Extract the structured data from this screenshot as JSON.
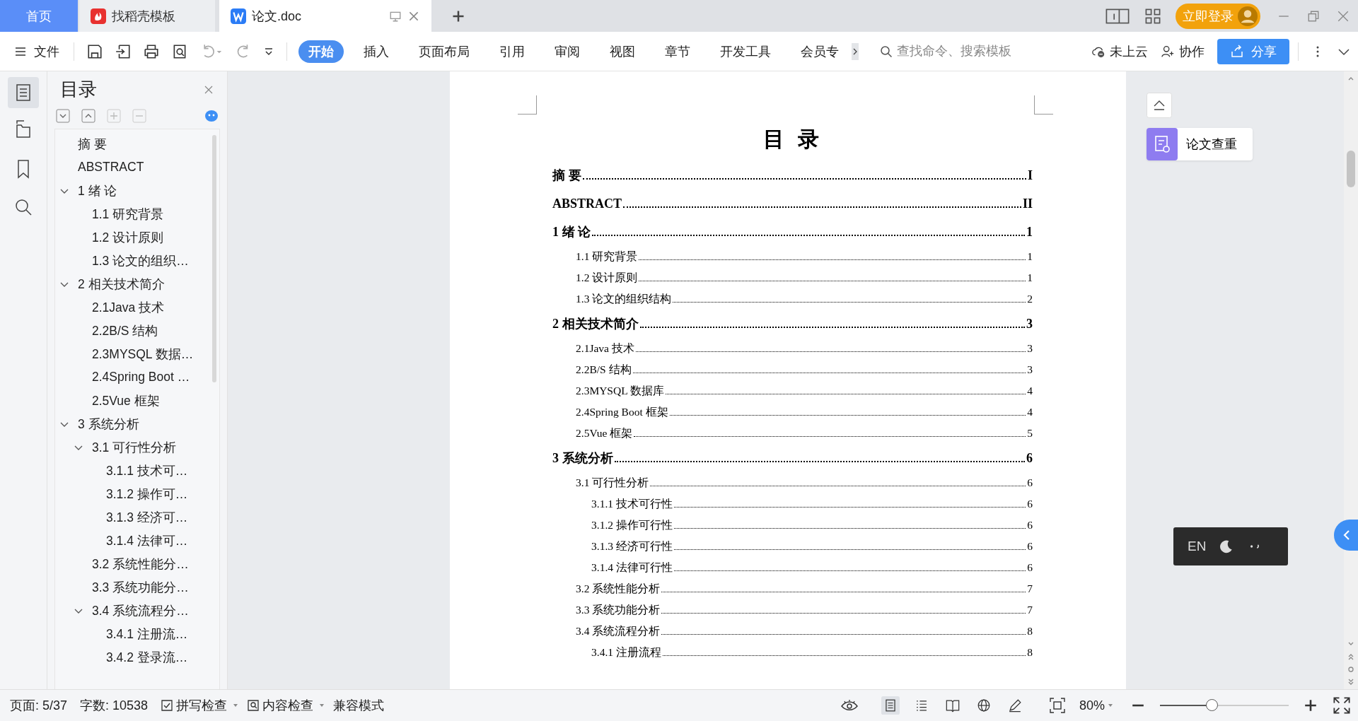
{
  "window_tabs": [
    {
      "label": "首页",
      "kind": "home",
      "selected": false
    },
    {
      "label": "找稻壳模板",
      "kind": "docer",
      "selected": false
    },
    {
      "label": "论文.doc",
      "kind": "doc",
      "selected": true
    }
  ],
  "login_button": "立即登录",
  "file_menu": "文件",
  "ribbon_tabs": [
    {
      "label": "开始",
      "selected": true
    },
    {
      "label": "插入",
      "selected": false
    },
    {
      "label": "页面布局",
      "selected": false
    },
    {
      "label": "引用",
      "selected": false
    },
    {
      "label": "审阅",
      "selected": false
    },
    {
      "label": "视图",
      "selected": false
    },
    {
      "label": "章节",
      "selected": false
    },
    {
      "label": "开发工具",
      "selected": false
    },
    {
      "label": "会员专",
      "selected": false
    }
  ],
  "search": {
    "placeholder": "查找命令、搜索模板"
  },
  "cloud_status": "未上云",
  "collab": "协作",
  "share": "分享",
  "toc_panel": {
    "title": "目录",
    "items": [
      {
        "label": "摘 要"
      },
      {
        "label": "ABSTRACT"
      },
      {
        "label": "1 绪 论",
        "expanded": true,
        "children": [
          {
            "label": "1.1 研究背景"
          },
          {
            "label": "1.2 设计原则"
          },
          {
            "label": "1.3 论文的组织…"
          }
        ]
      },
      {
        "label": "2  相关技术简介",
        "expanded": true,
        "children": [
          {
            "label": "2.1Java 技术"
          },
          {
            "label": "2.2B/S 结构"
          },
          {
            "label": "2.3MYSQL 数据…"
          },
          {
            "label": "2.4Spring Boot …"
          },
          {
            "label": "2.5Vue 框架"
          }
        ]
      },
      {
        "label": "3  系统分析",
        "expanded": true,
        "children": [
          {
            "label": "3.1 可行性分析",
            "expanded": true,
            "children": [
              {
                "label": "3.1.1 技术可…"
              },
              {
                "label": "3.1.2 操作可…"
              },
              {
                "label": "3.1.3 经济可…"
              },
              {
                "label": "3.1.4 法律可…"
              }
            ]
          },
          {
            "label": "3.2 系统性能分…"
          },
          {
            "label": "3.3 系统功能分…"
          },
          {
            "label": "3.4 系统流程分…",
            "expanded": true,
            "children": [
              {
                "label": "3.4.1 注册流…"
              },
              {
                "label": "3.4.2 登录流…"
              }
            ]
          }
        ]
      }
    ]
  },
  "document": {
    "heading": "目 录",
    "entries": [
      {
        "title": "摘 要",
        "page": "I"
      },
      {
        "title": "ABSTRACT",
        "page": "II"
      },
      {
        "title": "1 绪  论",
        "page": "1",
        "children": [
          {
            "title": "1.1 研究背景",
            "page": "1"
          },
          {
            "title": "1.2 设计原则",
            "page": "1"
          },
          {
            "title": "1.3 论文的组织结构",
            "page": "2"
          }
        ]
      },
      {
        "title": "2  相关技术简介",
        "page": "3",
        "children": [
          {
            "title": "2.1Java 技术",
            "page": "3"
          },
          {
            "title": "2.2B/S 结构",
            "page": "3"
          },
          {
            "title": "2.3MYSQL 数据库",
            "page": "4"
          },
          {
            "title": "2.4Spring Boot 框架",
            "page": "4"
          },
          {
            "title": "2.5Vue 框架",
            "page": "5"
          }
        ]
      },
      {
        "title": "3  系统分析",
        "page": "6",
        "children": [
          {
            "title": "3.1 可行性分析",
            "page": "6",
            "children": [
              {
                "title": "3.1.1 技术可行性",
                "page": "6"
              },
              {
                "title": "3.1.2 操作可行性",
                "page": "6"
              },
              {
                "title": "3.1.3 经济可行性",
                "page": "6"
              },
              {
                "title": "3.1.4 法律可行性",
                "page": "6"
              }
            ]
          },
          {
            "title": "3.2 系统性能分析",
            "page": "7"
          },
          {
            "title": "3.3 系统功能分析",
            "page": "7"
          },
          {
            "title": "3.4 系统流程分析",
            "page": "8",
            "children": [
              {
                "title": "3.4.1 注册流程",
                "page": "8"
              }
            ]
          }
        ]
      }
    ]
  },
  "plagiarism_check": "论文查重",
  "ime": {
    "mode": "EN"
  },
  "status_bar": {
    "page": "页面: 5/37",
    "words": "字数: 10538",
    "spell_check": "拼写检查",
    "content_check": "内容检查",
    "compat": "兼容模式",
    "views": [
      {
        "kind": "page",
        "selected": true
      },
      {
        "kind": "outline",
        "selected": false
      },
      {
        "kind": "read",
        "selected": false
      },
      {
        "kind": "web",
        "selected": false
      },
      {
        "kind": "write",
        "selected": false
      }
    ],
    "zoom": "80%",
    "zoom_slider": {
      "level": 0.4
    }
  }
}
